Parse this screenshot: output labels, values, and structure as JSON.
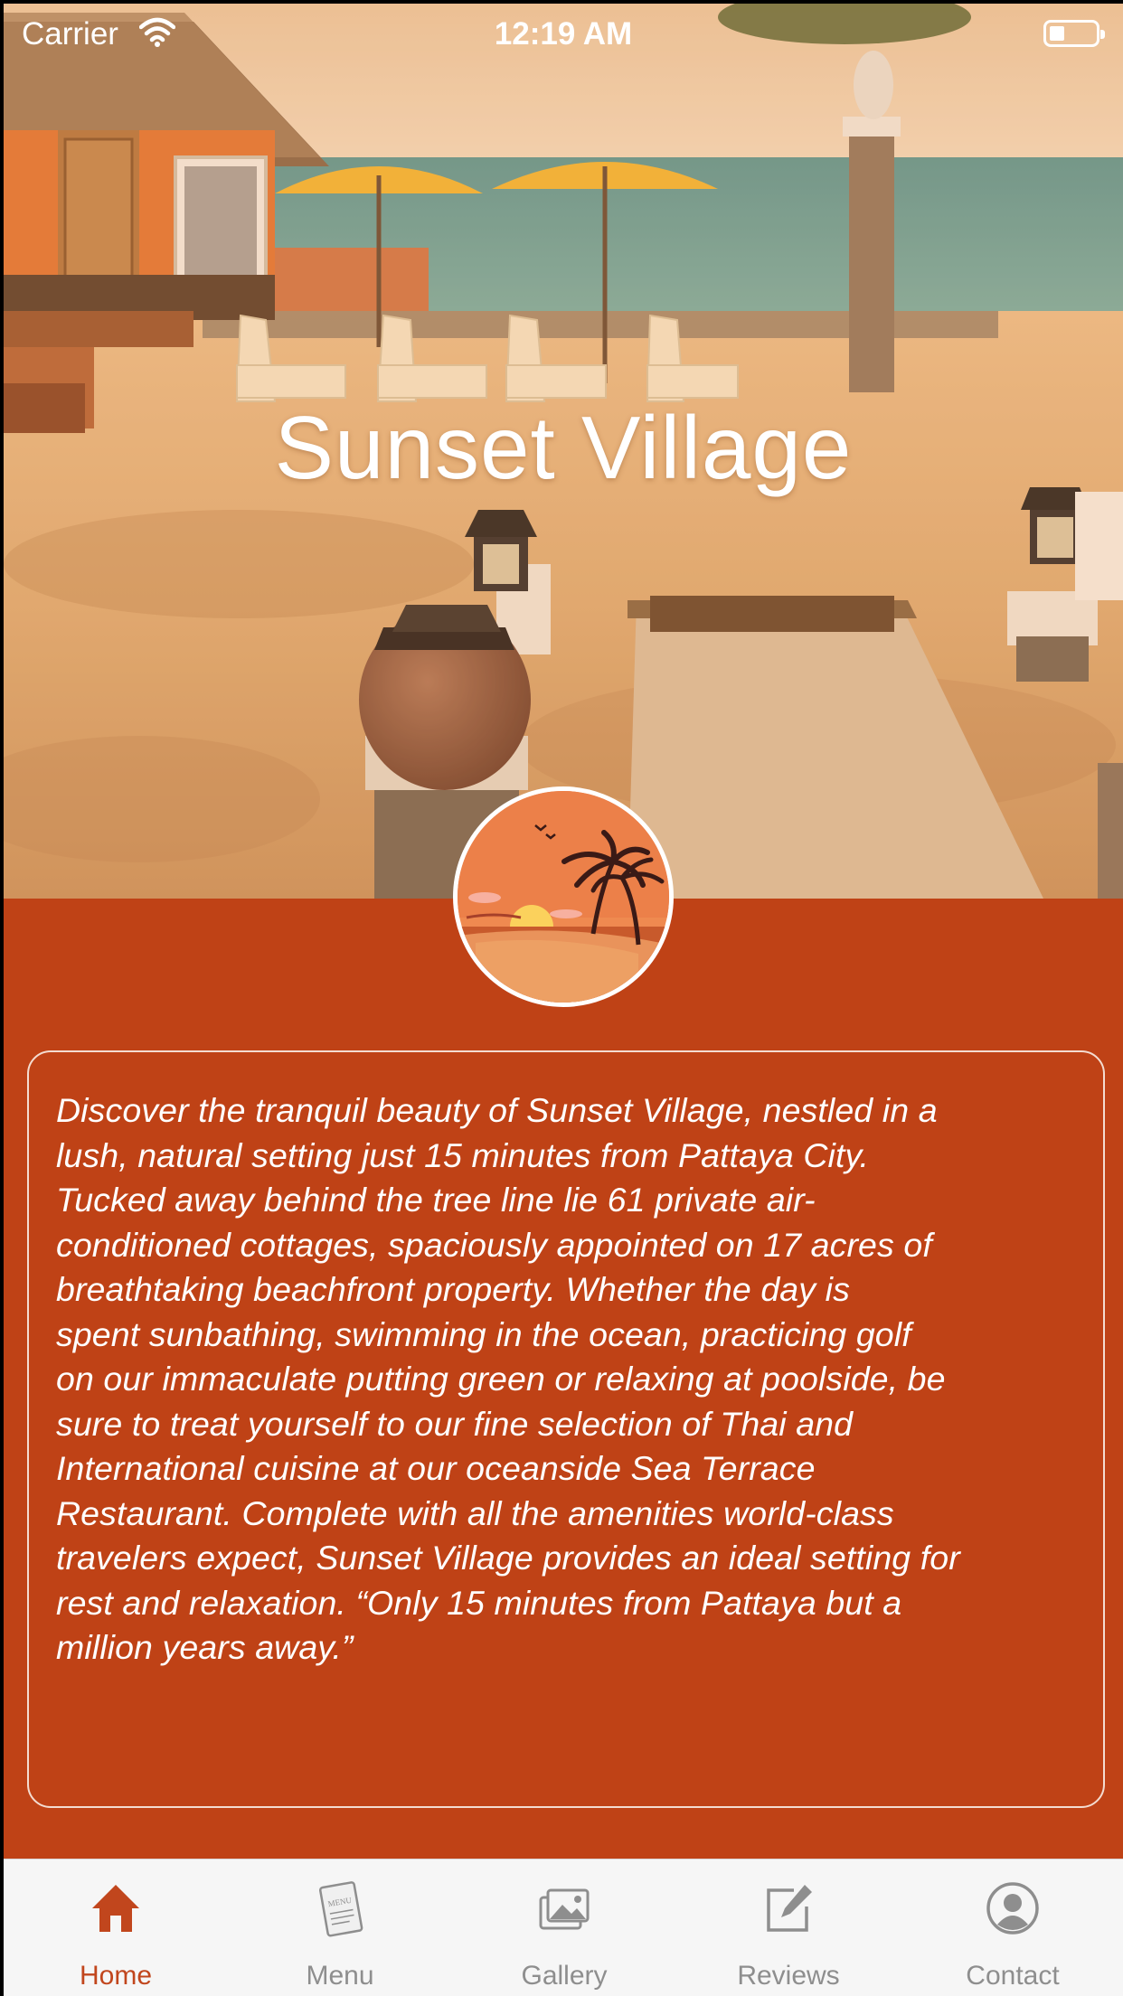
{
  "status_bar": {
    "carrier": "Carrier",
    "time": "12:19 AM"
  },
  "hero": {
    "title": "Sunset Village"
  },
  "description": {
    "text": "Discover the tranquil beauty of Sunset Village, nestled in a\nlush, natural setting just 15 minutes from Pattaya City.\nTucked away behind the tree line lie 61 private air-\nconditioned cottages, spaciously appointed on 17 acres of\nbreathtaking beachfront property.  Whether the day is\nspent sunbathing, swimming in the ocean, practicing golf\non our immaculate putting green or relaxing at poolside, be\nsure to treat yourself to our fine selection of Thai and\nInternational cuisine at our oceanside Sea Terrace\nRestaurant. Complete with all the amenities world-class\ntravelers expect, Sunset Village provides an ideal setting for\nrest and relaxation.  “Only 15 minutes from Pattaya but a\nmillion years away.”"
  },
  "tab_bar": {
    "tabs": [
      {
        "label": "Home",
        "icon": "home-icon",
        "active": true
      },
      {
        "label": "Menu",
        "icon": "menu-card-icon",
        "active": false
      },
      {
        "label": "Gallery",
        "icon": "gallery-icon",
        "active": false
      },
      {
        "label": "Reviews",
        "icon": "edit-icon",
        "active": false
      },
      {
        "label": "Contact",
        "icon": "person-icon",
        "active": false
      }
    ]
  },
  "colors": {
    "background": "#bf4216",
    "active_tab": "#c1461d",
    "inactive_tab": "#8e8e8e",
    "tab_bar": "#f6f6f6"
  }
}
